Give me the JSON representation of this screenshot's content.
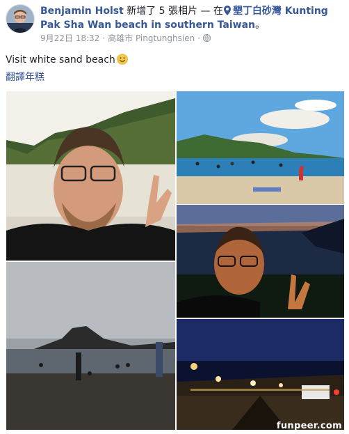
{
  "post": {
    "author": "Benjamin Holst",
    "action": " 新增了 5 張相片 — 在",
    "location": "墾丁白砂灣 Kunting Pak Sha Wan beach in southern Taiwan",
    "location_suffix": "。",
    "date": "9月22日 18:32",
    "separator": "·",
    "place": "高雄市 Pingtunghsien",
    "text": "Visit white sand beach",
    "translate_label": "翻譯年糕"
  },
  "photos": [
    {
      "desc": "selfie-white-sand-beach"
    },
    {
      "desc": "beach-crowd-afternoon"
    },
    {
      "desc": "dusk-beach-swimmers"
    },
    {
      "desc": "night-selfie-peace-sign"
    },
    {
      "desc": "night-street-lights"
    }
  ],
  "watermark": "funpeer.com",
  "colors": {
    "link": "#365899",
    "meta": "#90949c",
    "text": "#1d2129"
  }
}
